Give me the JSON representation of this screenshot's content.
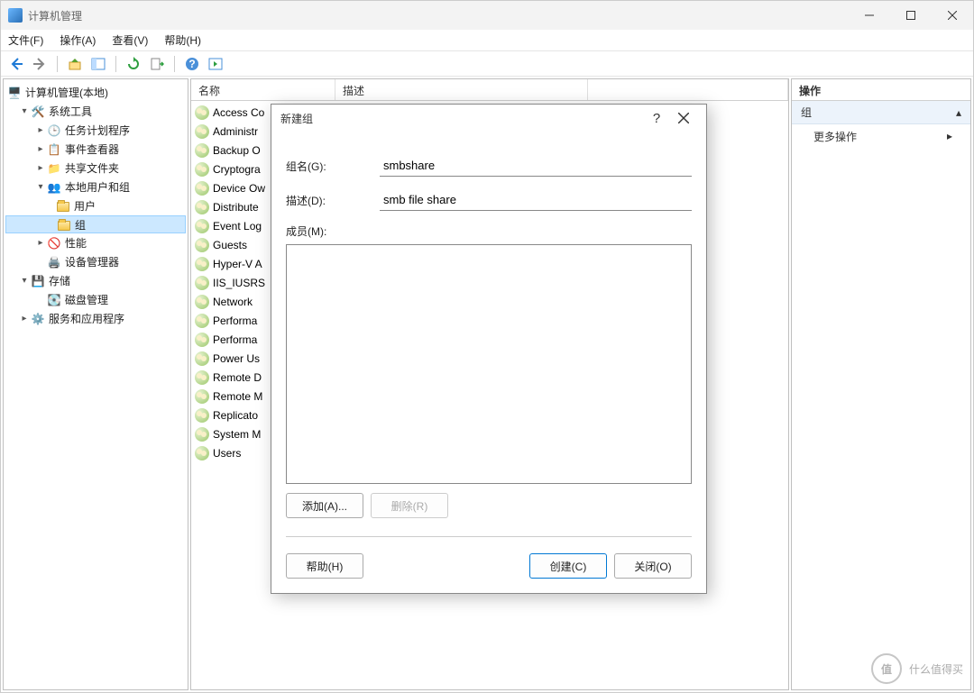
{
  "app": {
    "title": "计算机管理"
  },
  "menubar": {
    "file": "文件(F)",
    "action": "操作(A)",
    "view": "查看(V)",
    "help": "帮助(H)"
  },
  "tree": {
    "root": "计算机管理(本地)",
    "sys_tools": "系统工具",
    "task_scheduler": "任务计划程序",
    "event_viewer": "事件查看器",
    "shared_folders": "共享文件夹",
    "local_users_groups": "本地用户和组",
    "users": "用户",
    "groups": "组",
    "performance": "性能",
    "device_manager": "设备管理器",
    "storage": "存储",
    "disk_management": "磁盘管理",
    "services_apps": "服务和应用程序"
  },
  "list": {
    "col_name": "名称",
    "col_desc": "描述",
    "items": [
      "Access Co",
      "Administr",
      "Backup O",
      "Cryptogra",
      "Device Ow",
      "Distribute",
      "Event Log",
      "Guests",
      "Hyper-V A",
      "IIS_IUSRS",
      "Network ",
      "Performa",
      "Performa",
      "Power Us",
      "Remote D",
      "Remote M",
      "Replicato",
      "System M",
      "Users"
    ]
  },
  "actions": {
    "header": "操作",
    "section": "组",
    "more": "更多操作"
  },
  "dialog": {
    "title": "新建组",
    "name_label": "组名(G):",
    "name_value": "smbshare",
    "desc_label": "描述(D):",
    "desc_value": "smb file share",
    "members_label": "成员(M):",
    "add": "添加(A)...",
    "remove": "删除(R)",
    "help": "帮助(H)",
    "create": "创建(C)",
    "close": "关闭(O)"
  },
  "watermark": {
    "text": "什么值得买"
  }
}
